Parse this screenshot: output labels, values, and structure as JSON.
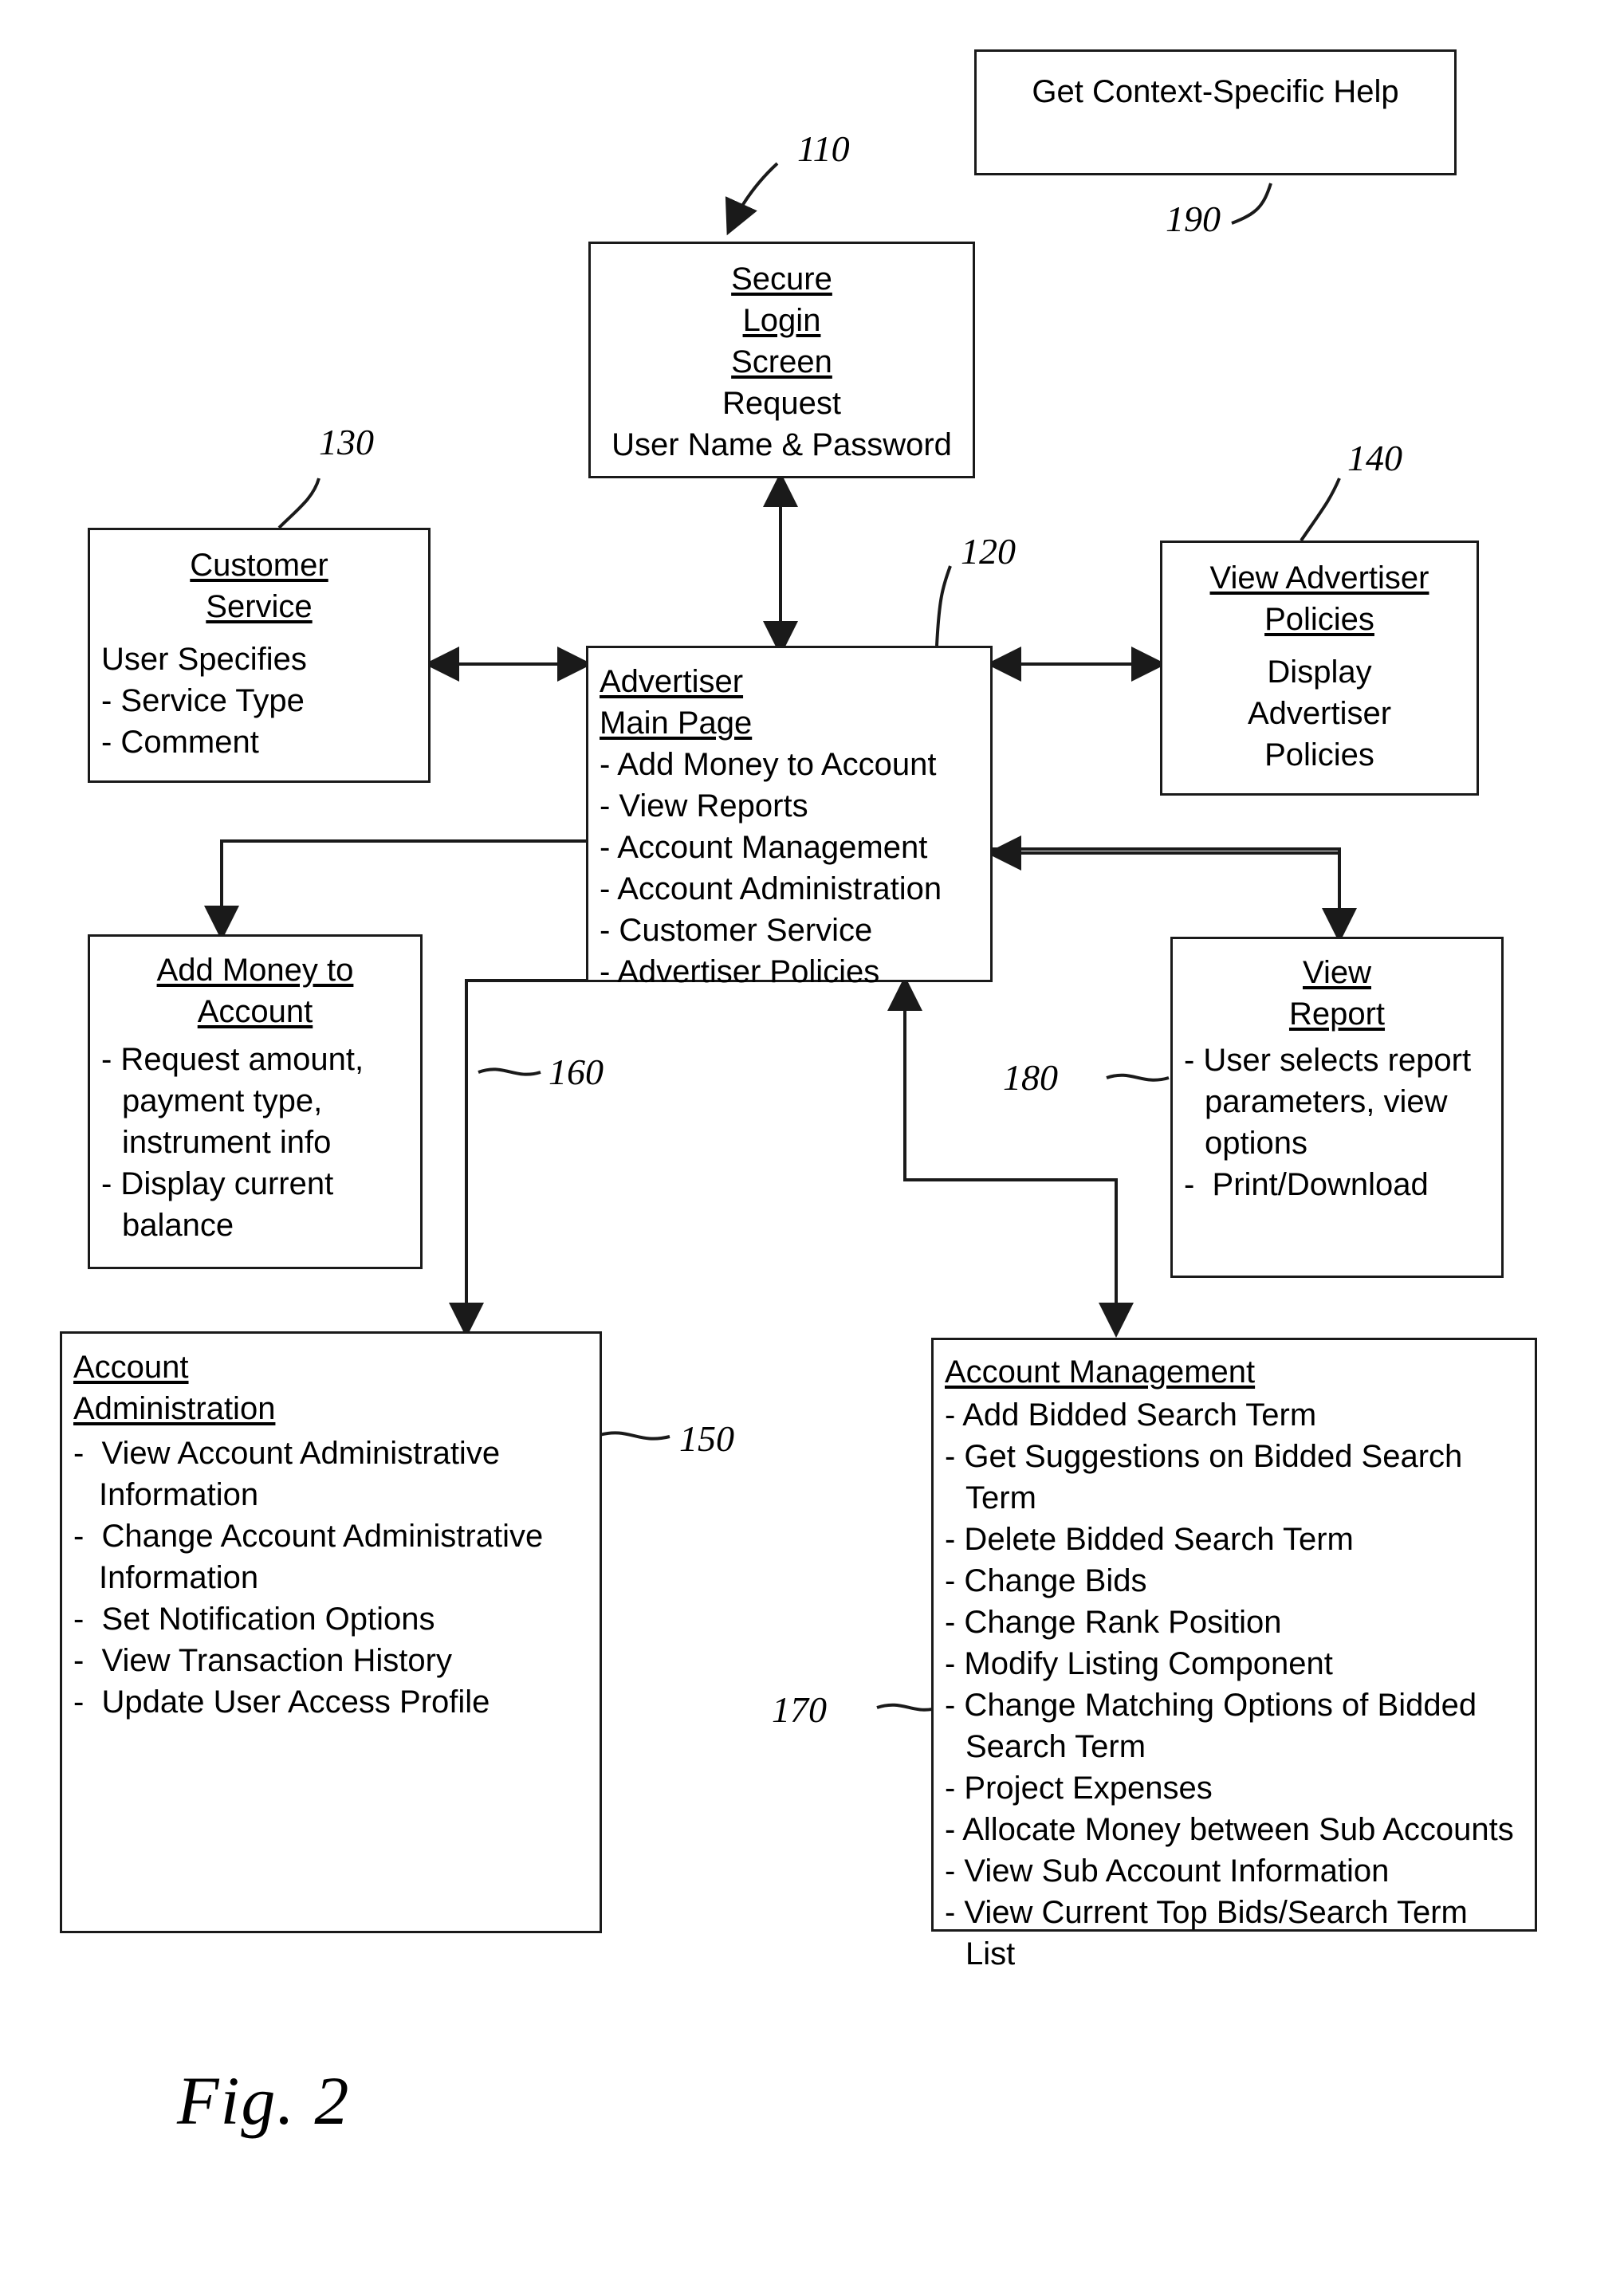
{
  "figure": {
    "caption": "Fig. 2"
  },
  "nodes": {
    "help": {
      "ref": "190",
      "title": "Get Context-Specific Help"
    },
    "login": {
      "ref": "110",
      "title_lines": [
        "Secure",
        "Login",
        "Screen"
      ],
      "body_lines": [
        "Request",
        "User Name & Password"
      ]
    },
    "customer_service": {
      "ref": "130",
      "title_lines": [
        "Customer",
        "Service"
      ],
      "body_lines": [
        "User Specifies",
        "- Service Type",
        "- Comment"
      ]
    },
    "advertiser_main": {
      "ref": "120",
      "title_lines": [
        "Advertiser",
        "Main Page"
      ],
      "items": [
        "- Add Money to Account",
        "- View Reports",
        "- Account Management",
        "- Account Administration",
        "- Customer Service",
        "- Advertiser Policies"
      ]
    },
    "advertiser_policies": {
      "ref": "140",
      "title_lines": [
        "View Advertiser",
        "Policies"
      ],
      "body_lines": [
        "Display",
        "Advertiser",
        "Policies"
      ]
    },
    "add_money": {
      "ref": "160",
      "title_lines": [
        "Add Money to",
        "Account"
      ],
      "items": [
        "- Request amount, payment type, instrument info",
        "- Display current balance"
      ]
    },
    "view_report": {
      "ref": "180",
      "title_lines": [
        "View",
        "Report"
      ],
      "items": [
        "- User selects report parameters, view options",
        "-  Print/Download"
      ]
    },
    "account_admin": {
      "ref": "150",
      "title_lines": [
        "Account",
        "Administration"
      ],
      "items": [
        "-  View Account Administrative Information",
        "-  Change Account Administrative Information",
        "-  Set Notification Options",
        "-  View Transaction History",
        "-  Update User Access Profile"
      ]
    },
    "account_management": {
      "ref": "170",
      "title_lines": [
        "Account Management"
      ],
      "items": [
        "- Add Bidded Search Term",
        "- Get Suggestions on Bidded Search Term",
        "- Delete Bidded Search Term",
        "- Change Bids",
        "- Change Rank Position",
        "- Modify Listing Component",
        "- Change Matching Options of Bidded Search Term",
        "- Project Expenses",
        "- Allocate Money between Sub Accounts",
        "- View Sub Account Information",
        "- View Current Top Bids/Search Term List"
      ]
    }
  }
}
